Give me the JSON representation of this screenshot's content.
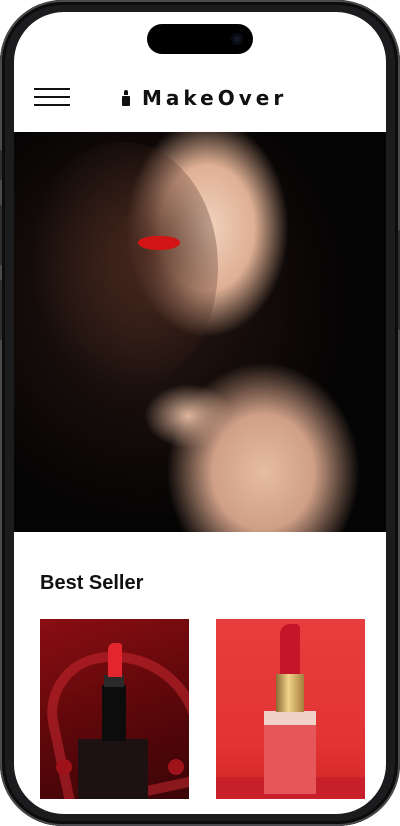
{
  "app": {
    "brand_name": "MakeOver",
    "brand_icon": "lipstick-icon",
    "menu_icon": "hamburger-menu-icon"
  },
  "hero": {
    "image": "model-red-lipstick-photo"
  },
  "best_seller": {
    "title": "Best Seller",
    "products": [
      {
        "image": "black-lipstick-on-red-background"
      },
      {
        "image": "red-lipstick-on-red-background"
      }
    ]
  },
  "colors": {
    "accent_red": "#e33434",
    "text": "#111111",
    "background": "#ffffff"
  }
}
